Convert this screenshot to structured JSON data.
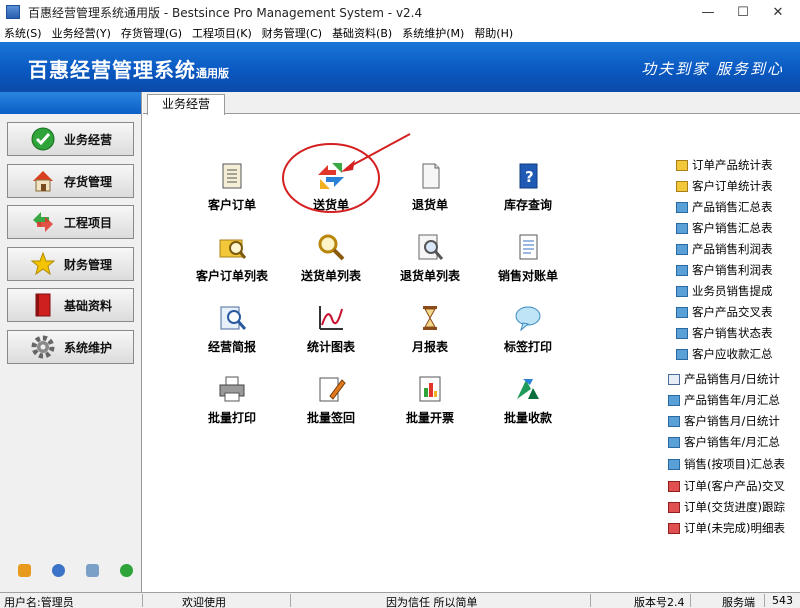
{
  "window": {
    "title": "百惠经营管理系统通用版 - Bestsince Pro Management System - v2.4",
    "controls": [
      "minimize-icon",
      "maximize-icon",
      "close-icon"
    ]
  },
  "menu": [
    "系统(S)",
    "业务经营(Y)",
    "存货管理(G)",
    "工程项目(K)",
    "财务管理(C)",
    "基础资料(B)",
    "系统维护(M)",
    "帮助(H)"
  ],
  "banner": {
    "title": "百惠经营管理系统",
    "edition": "通用版",
    "slogan": "功夫到家 服务到心"
  },
  "sidebar": {
    "items": [
      {
        "label": "业务经营",
        "icon": "check-circle-icon"
      },
      {
        "label": "存货管理",
        "icon": "house-icon"
      },
      {
        "label": "工程项目",
        "icon": "arrows-cycle-icon"
      },
      {
        "label": "财务管理",
        "icon": "star-icon"
      },
      {
        "label": "基础资料",
        "icon": "book-icon"
      },
      {
        "label": "系统维护",
        "icon": "gear-icon"
      }
    ],
    "bottom_icons": [
      "tool-icon",
      "clock-icon",
      "search-doc-icon",
      "refresh-icon"
    ]
  },
  "tab": {
    "label": "业务经营"
  },
  "tiles": [
    {
      "label": "客户订单",
      "icon": "scroll-icon"
    },
    {
      "label": "送货单",
      "icon": "swap-arrows-icon"
    },
    {
      "label": "退货单",
      "icon": "paper-icon"
    },
    {
      "label": "库存查询",
      "icon": "help-book-icon"
    },
    {
      "label": "客户订单列表",
      "icon": "folder-search-icon"
    },
    {
      "label": "送货单列表",
      "icon": "magnifier-icon"
    },
    {
      "label": "退货单列表",
      "icon": "doc-search-icon"
    },
    {
      "label": "销售对账单",
      "icon": "document-icon"
    },
    {
      "label": "经营简报",
      "icon": "report-search-icon"
    },
    {
      "label": "统计图表",
      "icon": "line-chart-icon"
    },
    {
      "label": "月报表",
      "icon": "hourglass-icon"
    },
    {
      "label": "标签打印",
      "icon": "speech-bubble-icon"
    },
    {
      "label": "批量打印",
      "icon": "printer-icon"
    },
    {
      "label": "批量签回",
      "icon": "pen-doc-icon"
    },
    {
      "label": "批量开票",
      "icon": "bar-doc-icon"
    },
    {
      "label": "批量收款",
      "icon": "recycle-icon"
    }
  ],
  "reports": [
    {
      "label": "订单产品统计表",
      "icon": "folder-icon"
    },
    {
      "label": "客户订单统计表",
      "icon": "folder-icon"
    },
    {
      "label": "产品销售汇总表",
      "icon": "report-icon"
    },
    {
      "label": "客户销售汇总表",
      "icon": "report-icon"
    },
    {
      "label": "产品销售利润表",
      "icon": "report-icon"
    },
    {
      "label": "客户销售利润表",
      "icon": "report-icon"
    },
    {
      "label": "业务员销售提成",
      "icon": "report-icon"
    },
    {
      "label": "客户产品交叉表",
      "icon": "report-icon"
    },
    {
      "label": "客户销售状态表",
      "icon": "report-icon"
    },
    {
      "label": "客户应收款汇总",
      "icon": "report-icon"
    },
    {
      "label": "产品销售月/日统计",
      "icon": "grid-icon"
    },
    {
      "label": "产品销售年/月汇总",
      "icon": "report-icon"
    },
    {
      "label": "客户销售月/日统计",
      "icon": "report-icon"
    },
    {
      "label": "客户销售年/月汇总",
      "icon": "report-icon"
    },
    {
      "label": "销售(按项目)汇总表",
      "icon": "report-icon"
    },
    {
      "label": "订单(客户产品)交叉",
      "icon": "red-report-icon"
    },
    {
      "label": "订单(交货进度)跟踪",
      "icon": "red-report-icon"
    },
    {
      "label": "订单(未完成)明细表",
      "icon": "red-report-icon"
    }
  ],
  "status": {
    "user": "用户名:管理员",
    "welcome": "欢迎使用",
    "motto": "因为信任 所以简单",
    "version": "版本号2.4",
    "server": "服务端",
    "number": "543"
  },
  "colors": {
    "accent": "#0a59c2",
    "annotation": "#d42020"
  }
}
